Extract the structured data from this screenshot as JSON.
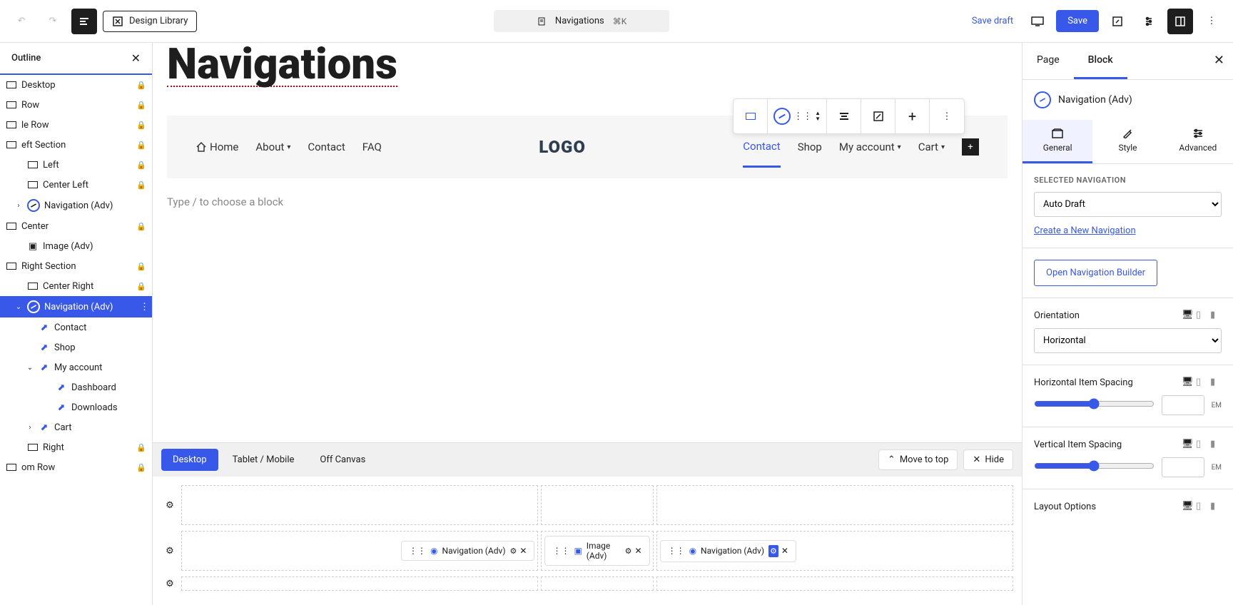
{
  "toolbar": {
    "design_library": "Design Library",
    "doc_title": "Navigations",
    "shortcut": "⌘K",
    "save_draft": "Save draft",
    "save": "Save"
  },
  "outline": {
    "title": "Outline",
    "items": [
      {
        "label": "Desktop",
        "locked": true,
        "indent": 0,
        "icon": "sq"
      },
      {
        "label": "Row",
        "locked": true,
        "indent": 0,
        "icon": "sq"
      },
      {
        "label": "le Row",
        "locked": true,
        "indent": 0,
        "icon": "sq"
      },
      {
        "label": "eft Section",
        "locked": true,
        "indent": 0,
        "icon": "sq"
      },
      {
        "label": "Left",
        "locked": true,
        "indent": 1,
        "icon": "sq"
      },
      {
        "label": "Center Left",
        "locked": true,
        "indent": 1,
        "icon": "sq"
      },
      {
        "label": "Navigation (Adv)",
        "locked": false,
        "indent": 1,
        "icon": "nav",
        "chevron": ">"
      },
      {
        "label": "Center",
        "locked": true,
        "indent": 0,
        "icon": "sq"
      },
      {
        "label": "Image (Adv)",
        "locked": false,
        "indent": 1,
        "icon": "img"
      },
      {
        "label": "Right Section",
        "locked": true,
        "indent": 0,
        "icon": "sq"
      },
      {
        "label": "Center Right",
        "locked": true,
        "indent": 1,
        "icon": "sq"
      },
      {
        "label": "Navigation (Adv)",
        "locked": false,
        "indent": 1,
        "icon": "nav",
        "chevron": "v",
        "selected": true
      },
      {
        "label": "Contact",
        "locked": false,
        "indent": 2,
        "icon": "link"
      },
      {
        "label": "Shop",
        "locked": false,
        "indent": 2,
        "icon": "link"
      },
      {
        "label": "My account",
        "locked": false,
        "indent": 2,
        "icon": "link",
        "chevron": "v"
      },
      {
        "label": "Dashboard",
        "locked": false,
        "indent": 3,
        "icon": "link"
      },
      {
        "label": "Downloads",
        "locked": false,
        "indent": 3,
        "icon": "link"
      },
      {
        "label": "Cart",
        "locked": false,
        "indent": 2,
        "icon": "link",
        "chevron": ">"
      },
      {
        "label": "Right",
        "locked": true,
        "indent": 1,
        "icon": "sq"
      },
      {
        "label": "om Row",
        "locked": true,
        "indent": 0,
        "icon": "sq"
      }
    ]
  },
  "canvas": {
    "page_title": "Navigations",
    "nav_left": [
      "Home",
      "About",
      "Contact",
      "FAQ"
    ],
    "logo": "LOGO",
    "nav_right": [
      "Contact",
      "Shop",
      "My account",
      "Cart"
    ],
    "prompt": "Type / to choose a block"
  },
  "builder": {
    "tabs": [
      "Desktop",
      "Tablet / Mobile",
      "Off Canvas"
    ],
    "move_to_top": "Move to top",
    "hide": "Hide",
    "blocks": {
      "nav1": "Navigation (Adv)",
      "img": "Image (Adv)",
      "nav2": "Navigation (Adv)"
    }
  },
  "sidebar": {
    "tabs": [
      "Page",
      "Block"
    ],
    "block_name": "Navigation (Adv)",
    "subtabs": [
      "General",
      "Style",
      "Advanced"
    ],
    "selected_nav_label": "SELECTED NAVIGATION",
    "selected_nav_value": "Auto Draft",
    "create_link": "Create a New Navigation",
    "open_builder": "Open Navigation Builder",
    "orientation_label": "Orientation",
    "orientation_value": "Horizontal",
    "h_spacing_label": "Horizontal Item Spacing",
    "v_spacing_label": "Vertical Item Spacing",
    "unit": "EM",
    "layout_options": "Layout Options"
  }
}
